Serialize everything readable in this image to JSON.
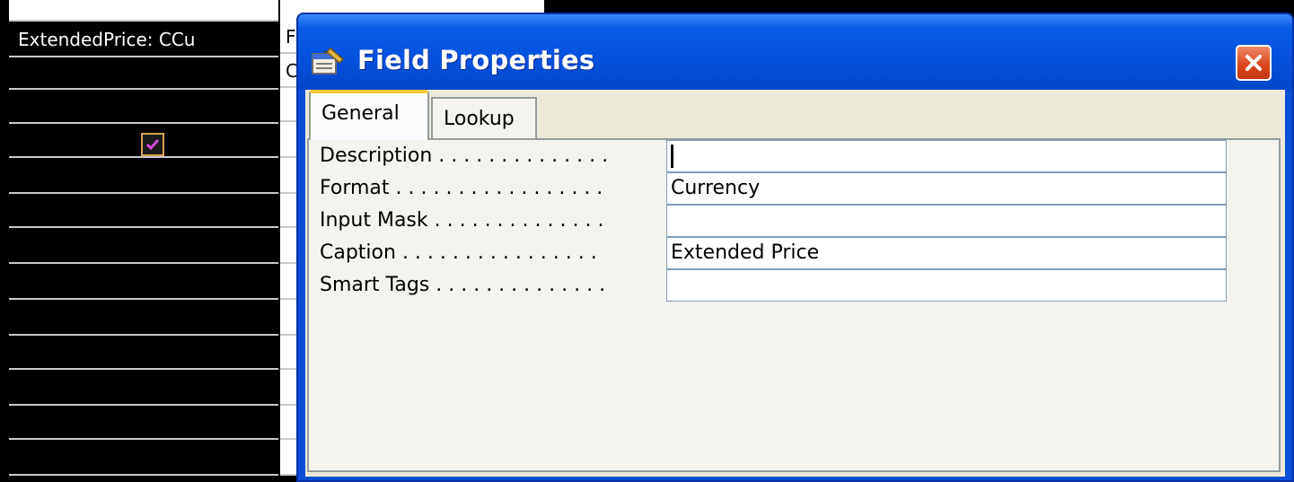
{
  "query_grid": {
    "field_value": "ExtendedPrice: CCu",
    "show_checked": true,
    "adjacent_column_rows": [
      "F",
      "C",
      "",
      "",
      "",
      "",
      "",
      "",
      "",
      "",
      "",
      "",
      ""
    ]
  },
  "dialog": {
    "title": "Field Properties",
    "title_icon": "properties-icon",
    "close_icon": "close-icon",
    "tabs": [
      {
        "label": "General",
        "active": true
      },
      {
        "label": "Lookup",
        "active": false
      }
    ],
    "properties": [
      {
        "label": "Description",
        "dots": " . . . . . . . . . . . . . .",
        "value": ""
      },
      {
        "label": "Format",
        "dots": " . . . . . . . . . . . . . . . . .",
        "value": "Currency"
      },
      {
        "label": "Input Mask",
        "dots": " . . . . . . . . . . . . . .",
        "value": ""
      },
      {
        "label": "Caption",
        "dots": " . . . . . . . . . . . . . . . .",
        "value": "Extended Price"
      },
      {
        "label": "Smart Tags",
        "dots": " . . . . . . . . . . . . . .",
        "value": ""
      }
    ]
  },
  "colors": {
    "titlebar": "#0552e0",
    "client_bg": "#ece9d8",
    "active_tab_highlight": "#ffc83c",
    "close_button": "#d64417"
  }
}
